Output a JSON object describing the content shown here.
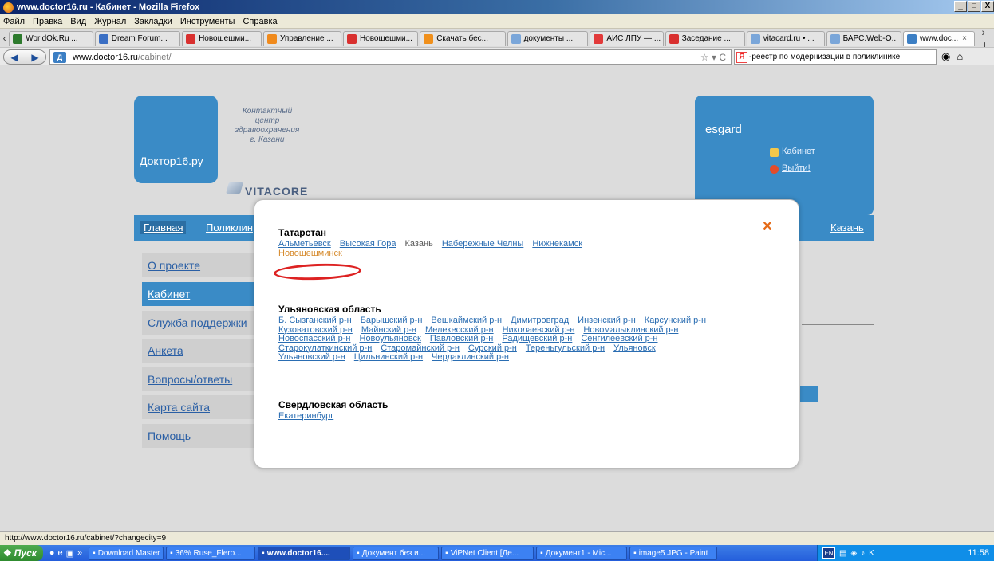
{
  "window": {
    "title": "www.doctor16.ru - Кабинет - Mozilla Firefox",
    "btn_min": "_",
    "btn_max": "□",
    "btn_close": "X"
  },
  "menu": [
    "Файл",
    "Правка",
    "Вид",
    "Журнал",
    "Закладки",
    "Инструменты",
    "Справка"
  ],
  "tabs": [
    {
      "label": "WorldOk.Ru ...",
      "color": "#2d7a2d"
    },
    {
      "label": "Dream Forum...",
      "color": "#3b6fc4"
    },
    {
      "label": "Новошешми...",
      "color": "#d9302f"
    },
    {
      "label": "Управление ...",
      "color": "#f08a1c"
    },
    {
      "label": "Новошешми...",
      "color": "#d9302f"
    },
    {
      "label": "Скачать бес...",
      "color": "#f0901c"
    },
    {
      "label": "документы ...",
      "color": "#7aa6d9"
    },
    {
      "label": "АИС ЛПУ — ...",
      "color": "#e23a3a"
    },
    {
      "label": "Заседание ...",
      "color": "#d9302f"
    },
    {
      "label": "vitacard.ru • ...",
      "color": "#7aa6d9"
    },
    {
      "label": "БАРС.Web-О...",
      "color": "#7aa6d9"
    },
    {
      "label": "www.doc...",
      "color": "#3c7fc4"
    }
  ],
  "nav": {
    "url_domain": "www.doctor16.ru",
    "url_path": "/cabinet/",
    "search": "-реестр по модернизации в поликлинике"
  },
  "site": {
    "logo": "Доктор16.ру",
    "tagline": [
      "Контактный",
      "центр",
      "здравоохранения",
      "г. Казани"
    ],
    "vitacore": "VITACORE",
    "user": "esgard",
    "link_cabinet": "Кабинет",
    "link_logout": "Выйти!",
    "nav_main": "Главная",
    "nav_clinic": "Поликлин",
    "nav_city": "Казань",
    "side": [
      "О проекте",
      "Кабинет",
      "Служба поддержки",
      "Анкета",
      "Вопросы/ответы",
      "Карта сайта",
      "Помощь"
    ]
  },
  "modal": {
    "close": "×",
    "regions": [
      {
        "name": "Татарстан",
        "lines": [
          [
            {
              "t": "Альметьевск",
              "k": "link"
            },
            {
              "t": "Высокая Гора",
              "k": "link"
            },
            {
              "t": "Казань",
              "k": "current"
            },
            {
              "t": "Набережные Челны",
              "k": "link"
            },
            {
              "t": "Нижнекамск",
              "k": "link"
            }
          ],
          [
            {
              "t": "Новошешминск",
              "k": "highlight"
            }
          ]
        ]
      },
      {
        "name": "Ульяновская область",
        "lines": [
          [
            {
              "t": "Б. Сызганский р-н",
              "k": "link"
            },
            {
              "t": "Барышский р-н",
              "k": "link"
            },
            {
              "t": "Вешкаймский р-н",
              "k": "link"
            },
            {
              "t": "Димитровград",
              "k": "link"
            },
            {
              "t": "Инзенский р-н",
              "k": "link"
            },
            {
              "t": "Карсунский р-н",
              "k": "link"
            }
          ],
          [
            {
              "t": "Кузоватовский р-н",
              "k": "link"
            },
            {
              "t": "Майнский р-н",
              "k": "link"
            },
            {
              "t": "Мелекесский р-н",
              "k": "link"
            },
            {
              "t": "Николаевский р-н",
              "k": "link"
            },
            {
              "t": "Новомалыклинский р-н",
              "k": "link"
            }
          ],
          [
            {
              "t": "Новоспасский р-н",
              "k": "link"
            },
            {
              "t": "Новоульяновск",
              "k": "link"
            },
            {
              "t": "Павловский р-н",
              "k": "link"
            },
            {
              "t": "Радищевский р-н",
              "k": "link"
            },
            {
              "t": "Сенгилеевский р-н",
              "k": "link"
            }
          ],
          [
            {
              "t": "Старокулаткинский р-н",
              "k": "link"
            },
            {
              "t": "Старомайнский р-н",
              "k": "link"
            },
            {
              "t": "Сурский р-н",
              "k": "link"
            },
            {
              "t": "Тереньгульский р-н",
              "k": "link"
            },
            {
              "t": "Ульяновск",
              "k": "link"
            }
          ],
          [
            {
              "t": "Ульяновский р-н",
              "k": "link"
            },
            {
              "t": "Цильнинский р-н",
              "k": "link"
            },
            {
              "t": "Чердаклинский р-н",
              "k": "link"
            }
          ]
        ]
      },
      {
        "name": "Свердловская область",
        "lines": [
          [
            {
              "t": "Екатеринбург",
              "k": "link"
            }
          ]
        ]
      }
    ]
  },
  "status_url": "http://www.doctor16.ru/cabinet/?changecity=9",
  "taskbar": {
    "start": "Пуск",
    "chevron": "»",
    "buttons": [
      {
        "label": "Download Master",
        "active": false
      },
      {
        "label": "36% Ruse_Flero...",
        "active": false
      },
      {
        "label": "www.doctor16....",
        "active": true
      },
      {
        "label": "Документ без и...",
        "active": false
      },
      {
        "label": "ViPNet Client [Де...",
        "active": false
      },
      {
        "label": "Документ1 - Mic...",
        "active": false
      },
      {
        "label": "image5.JPG - Paint",
        "active": false
      }
    ],
    "lang": "EN",
    "clock": "11:58"
  }
}
